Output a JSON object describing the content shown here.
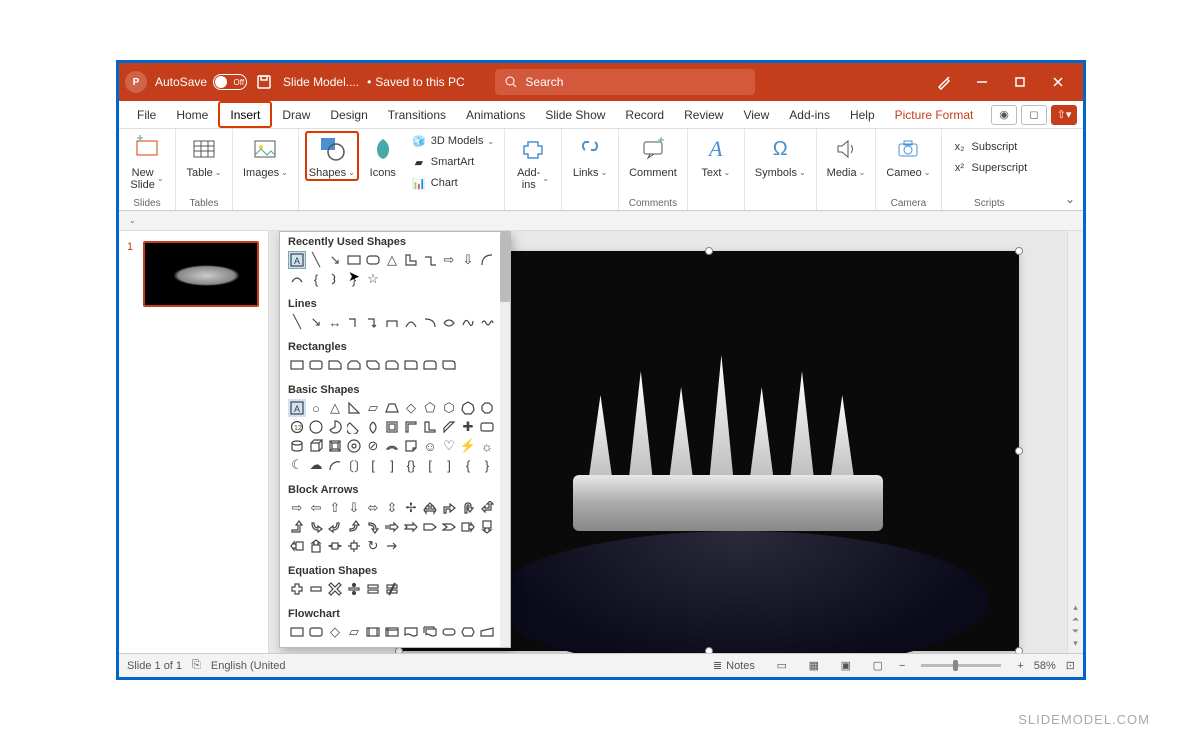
{
  "titlebar": {
    "autosave_label": "AutoSave",
    "autosave_state": "Off",
    "filename": "Slide Model....",
    "saved_location": "Saved to this PC",
    "search_placeholder": "Search"
  },
  "tabs": {
    "file": "File",
    "home": "Home",
    "insert": "Insert",
    "draw": "Draw",
    "design": "Design",
    "transitions": "Transitions",
    "animations": "Animations",
    "slideshow": "Slide Show",
    "record": "Record",
    "review": "Review",
    "view": "View",
    "addins": "Add-ins",
    "help": "Help",
    "pictureformat": "Picture Format"
  },
  "ribbon": {
    "slides": {
      "new_slide": "New\nSlide",
      "group": "Slides"
    },
    "tables": {
      "table": "Table",
      "group": "Tables"
    },
    "images": {
      "images": "Images"
    },
    "illustrations": {
      "shapes": "Shapes",
      "icons": "Icons",
      "models3d": "3D Models",
      "smartart": "SmartArt",
      "chart": "Chart"
    },
    "addins": {
      "addins": "Add-\nins",
      "dl": ""
    },
    "links": {
      "links": "Links"
    },
    "comments": {
      "comment": "Comment",
      "group": "Comments"
    },
    "text": {
      "text": "Text"
    },
    "symbols": {
      "symbols": "Symbols"
    },
    "media": {
      "media": "Media"
    },
    "camera": {
      "cameo": "Cameo",
      "group": "Camera"
    },
    "scripts": {
      "subscript": "Subscript",
      "superscript": "Superscript",
      "group": "Scripts"
    }
  },
  "shapes_menu": {
    "recently_used": "Recently Used Shapes",
    "lines": "Lines",
    "rectangles": "Rectangles",
    "basic_shapes": "Basic Shapes",
    "block_arrows": "Block Arrows",
    "equation_shapes": "Equation Shapes",
    "flowchart": "Flowchart"
  },
  "thumbnails": {
    "slide1_num": "1"
  },
  "statusbar": {
    "slide_count": "Slide 1 of 1",
    "language": "English (United",
    "notes": "Notes",
    "zoom_pct": "58%"
  },
  "watermark": "SLIDEMODEL.COM"
}
